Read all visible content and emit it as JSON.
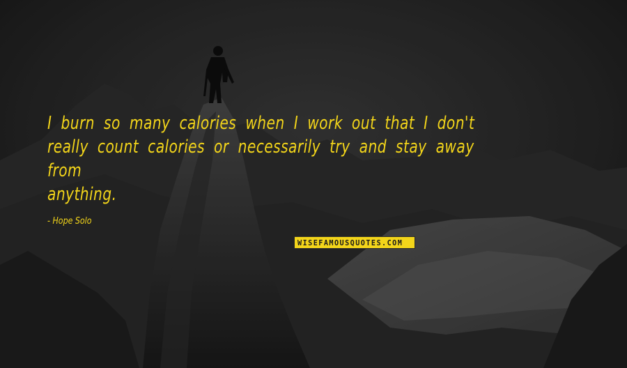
{
  "quote": {
    "line1": "I burn so many calories when I work out that I don't",
    "line2": "really count calories or necessarily try and stay away from",
    "line3": "anything.",
    "author": "- Hope Solo"
  },
  "brand": {
    "text": "WISEFAMOUSQUOTES.COM"
  },
  "colors": {
    "text": "#f3d51a",
    "background": "#1c1c1c",
    "brand_bg": "#f3d51a"
  }
}
